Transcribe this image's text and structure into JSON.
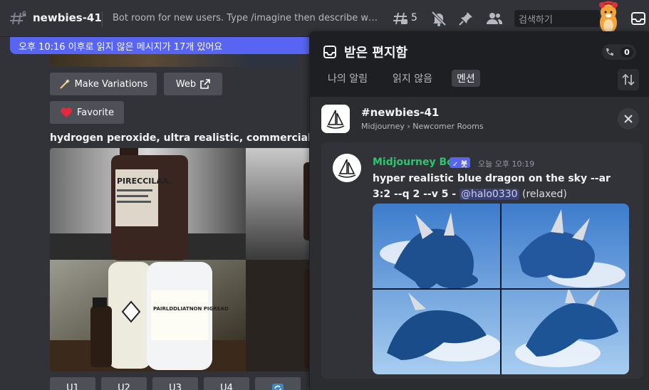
{
  "header": {
    "channel_name": "newbies-41",
    "topic": "Bot room for new users. Type /imagine then describe what you want to draw.",
    "threads_count": "5",
    "search_placeholder": "검색하기"
  },
  "banner": {
    "text": "오후 10:16 이후로 읽지 않은 메시지가 17개 있어요"
  },
  "chat": {
    "make_variations_label": "Make Variations",
    "web_label": "Web",
    "favorite_label": "Favorite",
    "prompt_text": "hydrogen peroxide, ultra realistic, commercial quality",
    "bottle_label_1": "PIRECCILAA.",
    "bottle_label_2": "PAIRLDDLIATNON PIGREAD",
    "upscale_buttons": [
      "U1",
      "U2",
      "U3",
      "U4"
    ]
  },
  "inbox": {
    "title": "받은 편지함",
    "badge_count": "0",
    "tabs": [
      "나의 알림",
      "읽지 않음",
      "멘션"
    ],
    "active_tab": "멘션",
    "channel_row": {
      "name": "newbies-41",
      "path": "Midjourney › Newcomer Rooms"
    },
    "message": {
      "author": "Midjourney Bot",
      "tag": "✓ 봇",
      "time": "오늘 오후 10:19",
      "text": "hyper realistic blue dragon on the sky --ar 3:2 --q 2 --v 5 - ",
      "mention": "@halo0330",
      "suffix": " (relaxed)"
    }
  },
  "colors": {
    "accent": "#5865f2",
    "bot_name": "#2dc770",
    "background": "#313338",
    "panel": "#2b2d31"
  }
}
